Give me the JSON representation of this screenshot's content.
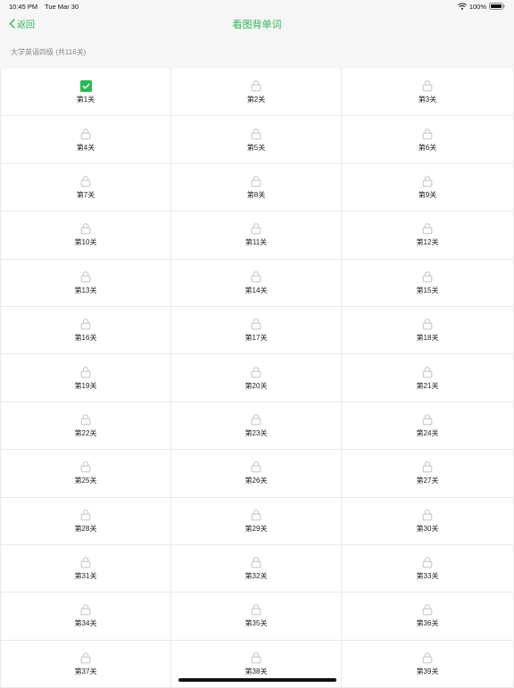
{
  "status_bar": {
    "time": "10:45 PM",
    "date": "Tue Mar 30",
    "battery": "100%"
  },
  "nav": {
    "back_label": "返回",
    "title": "看图背单词"
  },
  "section": {
    "title": "大学英语四级 (共116关)"
  },
  "colors": {
    "accent": "#2fb657",
    "lock": "#c8c8c8"
  },
  "levels": [
    {
      "label": "第1关",
      "status": "completed",
      "icon": "check-icon"
    },
    {
      "label": "第2关",
      "status": "locked",
      "icon": "lock-icon"
    },
    {
      "label": "第3关",
      "status": "locked",
      "icon": "lock-icon"
    },
    {
      "label": "第4关",
      "status": "locked",
      "icon": "lock-icon"
    },
    {
      "label": "第5关",
      "status": "locked",
      "icon": "lock-icon"
    },
    {
      "label": "第6关",
      "status": "locked",
      "icon": "lock-icon"
    },
    {
      "label": "第7关",
      "status": "locked",
      "icon": "lock-icon"
    },
    {
      "label": "第8关",
      "status": "locked",
      "icon": "lock-icon"
    },
    {
      "label": "第9关",
      "status": "locked",
      "icon": "lock-icon"
    },
    {
      "label": "第10关",
      "status": "locked",
      "icon": "lock-icon"
    },
    {
      "label": "第11关",
      "status": "locked",
      "icon": "lock-icon"
    },
    {
      "label": "第12关",
      "status": "locked",
      "icon": "lock-icon"
    },
    {
      "label": "第13关",
      "status": "locked",
      "icon": "lock-icon"
    },
    {
      "label": "第14关",
      "status": "locked",
      "icon": "lock-icon"
    },
    {
      "label": "第15关",
      "status": "locked",
      "icon": "lock-icon"
    },
    {
      "label": "第16关",
      "status": "locked",
      "icon": "lock-icon"
    },
    {
      "label": "第17关",
      "status": "locked",
      "icon": "lock-icon"
    },
    {
      "label": "第18关",
      "status": "locked",
      "icon": "lock-icon"
    },
    {
      "label": "第19关",
      "status": "locked",
      "icon": "lock-icon"
    },
    {
      "label": "第20关",
      "status": "locked",
      "icon": "lock-icon"
    },
    {
      "label": "第21关",
      "status": "locked",
      "icon": "lock-icon"
    },
    {
      "label": "第22关",
      "status": "locked",
      "icon": "lock-icon"
    },
    {
      "label": "第23关",
      "status": "locked",
      "icon": "lock-icon"
    },
    {
      "label": "第24关",
      "status": "locked",
      "icon": "lock-icon"
    },
    {
      "label": "第25关",
      "status": "locked",
      "icon": "lock-icon"
    },
    {
      "label": "第26关",
      "status": "locked",
      "icon": "lock-icon"
    },
    {
      "label": "第27关",
      "status": "locked",
      "icon": "lock-icon"
    },
    {
      "label": "第28关",
      "status": "locked",
      "icon": "lock-icon"
    },
    {
      "label": "第29关",
      "status": "locked",
      "icon": "lock-icon"
    },
    {
      "label": "第30关",
      "status": "locked",
      "icon": "lock-icon"
    },
    {
      "label": "第31关",
      "status": "locked",
      "icon": "lock-icon"
    },
    {
      "label": "第32关",
      "status": "locked",
      "icon": "lock-icon"
    },
    {
      "label": "第33关",
      "status": "locked",
      "icon": "lock-icon"
    },
    {
      "label": "第34关",
      "status": "locked",
      "icon": "lock-icon"
    },
    {
      "label": "第35关",
      "status": "locked",
      "icon": "lock-icon"
    },
    {
      "label": "第36关",
      "status": "locked",
      "icon": "lock-icon"
    },
    {
      "label": "第37关",
      "status": "locked",
      "icon": "lock-icon"
    },
    {
      "label": "第38关",
      "status": "locked",
      "icon": "lock-icon"
    },
    {
      "label": "第39关",
      "status": "locked",
      "icon": "lock-icon"
    }
  ]
}
